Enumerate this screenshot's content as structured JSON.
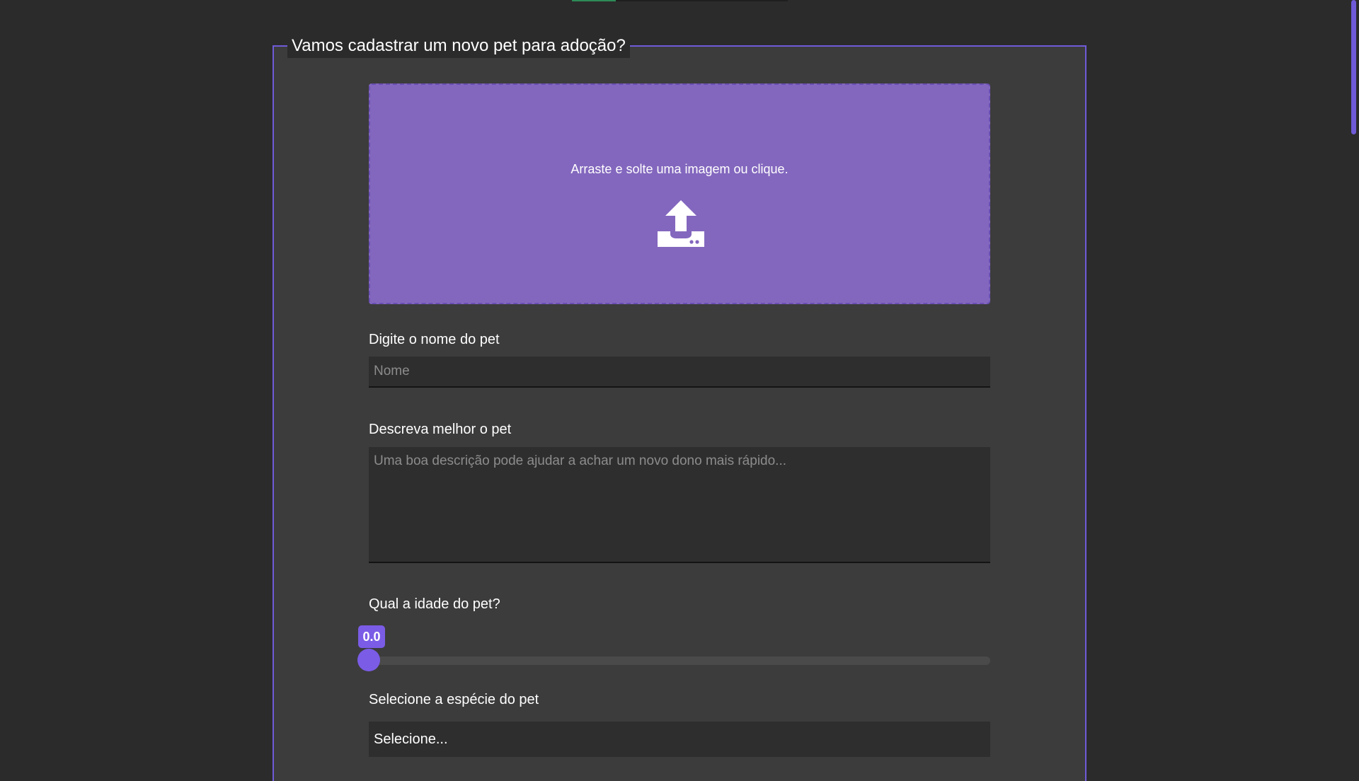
{
  "form": {
    "legend": "Vamos cadastrar um novo pet para adoção?",
    "upload": {
      "text": "Arraste e solte uma imagem ou clique.",
      "icon": "upload-icon"
    },
    "name": {
      "label": "Digite o nome do pet",
      "placeholder": "Nome",
      "value": ""
    },
    "description": {
      "label": "Descreva melhor o pet",
      "placeholder": "Uma boa descrição pode ajudar a achar um novo dono mais rápido...",
      "value": ""
    },
    "age": {
      "label": "Qual a idade do pet?",
      "value_text": "0.0",
      "value": 0.0
    },
    "species": {
      "label": "Selecione a espécie do pet",
      "selected": "Selecione..."
    }
  },
  "colors": {
    "accent": "#7b5ce6",
    "dropzone": "#8367be",
    "background": "#2b2b2b",
    "panel": "#3c3c3c"
  }
}
